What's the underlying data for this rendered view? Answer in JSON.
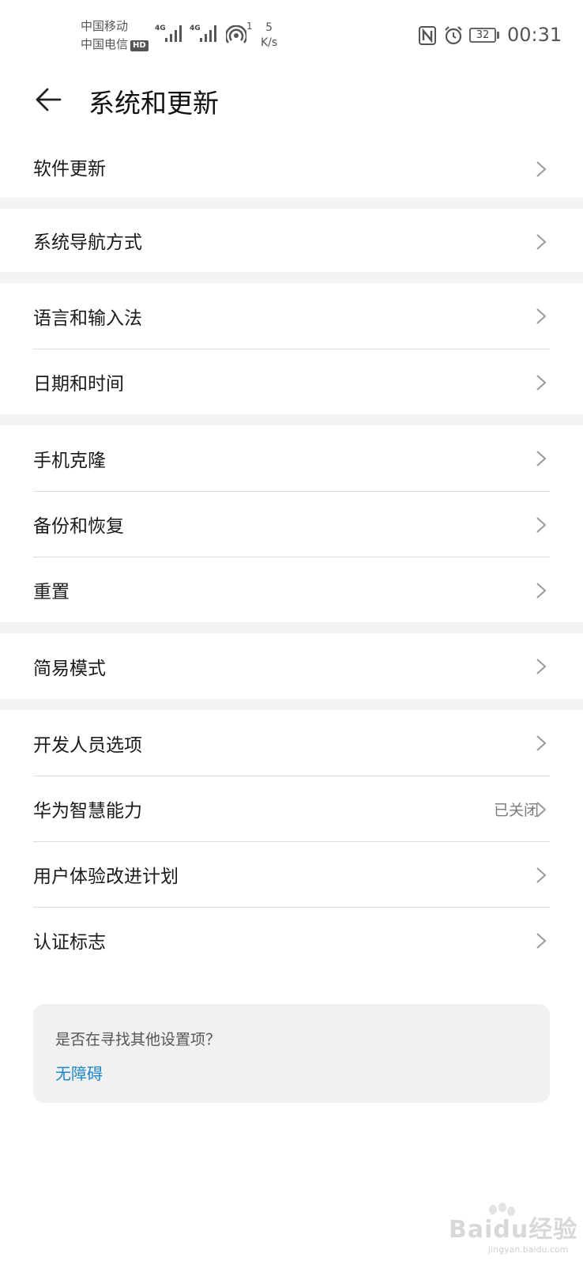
{
  "status_bar": {
    "carrier_1": "中国移动",
    "carrier_2": "中国电信",
    "hd_badge": "HD",
    "net_1": "4G",
    "net_2": "4G",
    "hotspot_count": "1",
    "speed_value": "5",
    "speed_unit": "K/s",
    "battery": "32",
    "time": "00:31"
  },
  "header": {
    "title": "系统和更新"
  },
  "groups": [
    {
      "items": [
        {
          "label": "软件更新",
          "value": ""
        }
      ]
    },
    {
      "items": [
        {
          "label": "系统导航方式",
          "value": ""
        }
      ]
    },
    {
      "items": [
        {
          "label": "语言和输入法",
          "value": ""
        },
        {
          "label": "日期和时间",
          "value": ""
        }
      ]
    },
    {
      "items": [
        {
          "label": "手机克隆",
          "value": ""
        },
        {
          "label": "备份和恢复",
          "value": ""
        },
        {
          "label": "重置",
          "value": ""
        }
      ]
    },
    {
      "items": [
        {
          "label": "简易模式",
          "value": ""
        }
      ]
    },
    {
      "items": [
        {
          "label": "开发人员选项",
          "value": ""
        },
        {
          "label": "华为智慧能力",
          "value": "已关闭"
        },
        {
          "label": "用户体验改进计划",
          "value": ""
        },
        {
          "label": "认证标志",
          "value": ""
        }
      ]
    }
  ],
  "suggestion": {
    "question": "是否在寻找其他设置项？",
    "link": "无障碍"
  },
  "watermark": {
    "text": "Baidu经验",
    "sub": "jingyan.baidu.com"
  },
  "colors": {
    "link": "#1e88c8",
    "separator": "#f3f3f3",
    "card": "#f1f1f1"
  }
}
